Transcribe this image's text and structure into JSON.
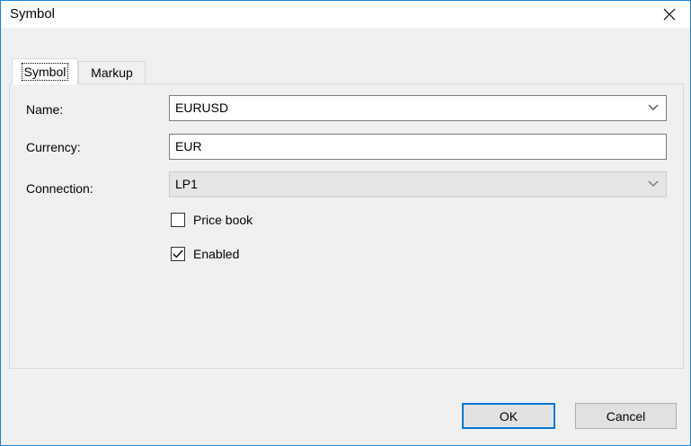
{
  "window": {
    "title": "Symbol"
  },
  "tabs": [
    {
      "label": "Symbol"
    },
    {
      "label": "Markup"
    }
  ],
  "form": {
    "name_label": "Name:",
    "name_value": "EURUSD",
    "currency_label": "Currency:",
    "currency_value": "EUR",
    "connection_label": "Connection:",
    "connection_value": "LP1",
    "price_book_label": "Price book",
    "price_book_checked": false,
    "enabled_label": "Enabled",
    "enabled_checked": true
  },
  "buttons": {
    "ok": "OK",
    "cancel": "Cancel"
  },
  "colors": {
    "accent": "#0078d7",
    "window_border": "#1883d7",
    "face": "#f0f0f0"
  },
  "icons": {
    "close": "close-icon",
    "dropdown": "chevron-down-icon",
    "check": "checkmark-icon"
  }
}
